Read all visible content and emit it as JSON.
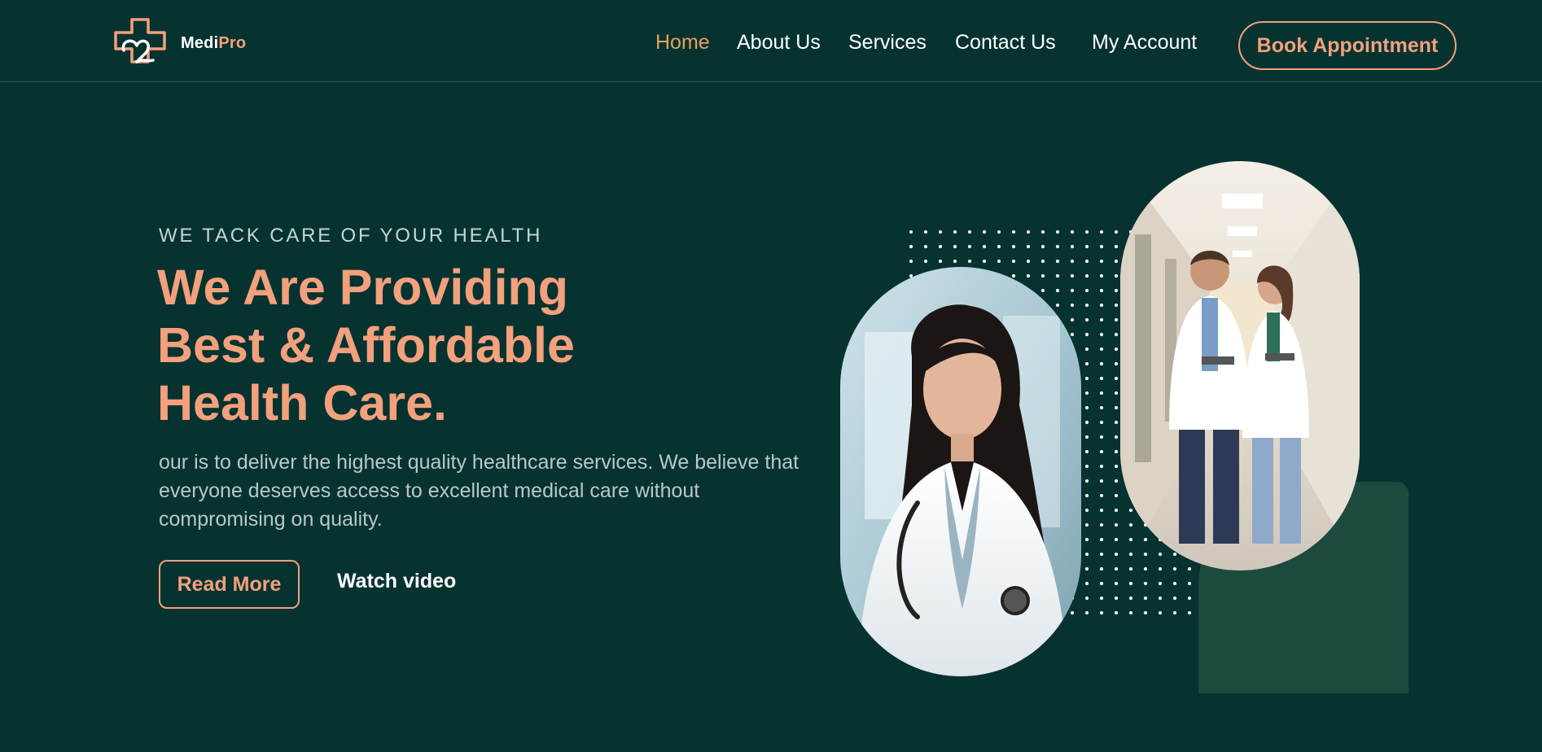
{
  "header": {
    "brand_main": "Medi",
    "brand_accent": "Pro",
    "nav": [
      {
        "label": "Home",
        "active": true
      },
      {
        "label": "About Us",
        "active": false
      },
      {
        "label": "Services",
        "active": false
      },
      {
        "label": "Contact Us",
        "active": false
      },
      {
        "label": "My Account",
        "active": false
      }
    ],
    "cta_label": "Book Appointment",
    "logo_icon": "medical-cross-heart-icon"
  },
  "hero": {
    "eyebrow": "WE TACK CARE OF YOUR HEALTH",
    "headline_lines": [
      "We Are Providing",
      "Best & Affordable",
      "Health Care."
    ],
    "description": "our is to deliver the highest quality healthcare services. We believe that everyone deserves access to excellent medical care without compromising on quality.",
    "read_more_label": "Read More",
    "watch_video_label": "Watch video",
    "images": [
      {
        "subject": "female doctor with stethoscope"
      },
      {
        "subject": "two doctors walking in hospital corridor"
      }
    ]
  },
  "colors": {
    "background": "#063330",
    "accent": "#f3a07d",
    "active_nav": "#e4a05f",
    "decor_block": "#1d4a3e",
    "muted_text": "#b9c9c6"
  }
}
